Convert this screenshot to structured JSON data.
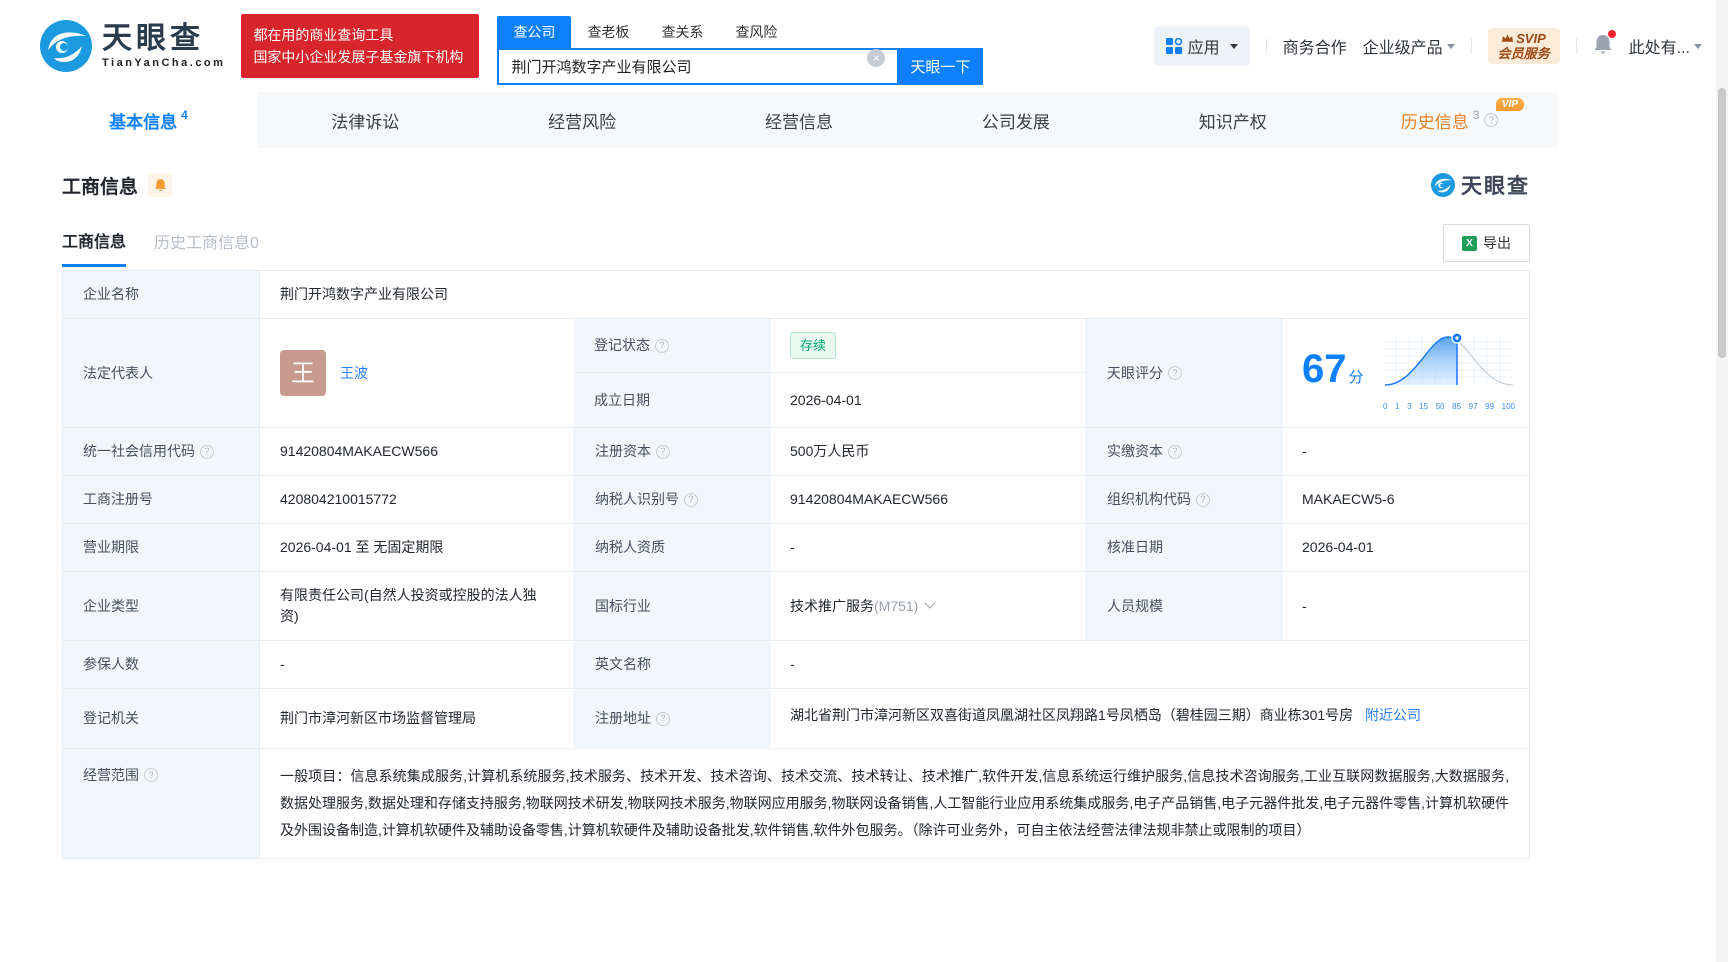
{
  "colors": {
    "accent": "#0d80ff",
    "banner_red": "#d7252b",
    "status_green": "#00a870",
    "vip_orange": "#f59a2e"
  },
  "header": {
    "logo": {
      "title": "天眼查",
      "domain": "TianYanCha.com"
    },
    "banner": {
      "line1": "都在用的商业查询工具",
      "line2": "国家中小企业发展子基金旗下机构"
    },
    "search": {
      "tabs": [
        {
          "label": "查公司",
          "active": true
        },
        {
          "label": "查老板",
          "active": false
        },
        {
          "label": "查关系",
          "active": false
        },
        {
          "label": "查风险",
          "active": false
        }
      ],
      "value": "荆门开鸿数字产业有限公司",
      "button": "天眼一下"
    },
    "nav": {
      "apps": "应用",
      "coop": "商务合作",
      "enterprise": "企业级产品",
      "svip": {
        "line1": "SVIP",
        "line2": "会员服务"
      },
      "user": "此处有..."
    }
  },
  "tabs": [
    {
      "label": "基本信息",
      "count": "4",
      "active": true
    },
    {
      "label": "法律诉讼"
    },
    {
      "label": "经营风险"
    },
    {
      "label": "经营信息"
    },
    {
      "label": "公司发展"
    },
    {
      "label": "知识产权"
    },
    {
      "label": "历史信息",
      "count": "3",
      "badge": "VIP"
    }
  ],
  "section": {
    "title": "工商信息",
    "watermark": "天眼查",
    "subtabs": [
      {
        "label": "工商信息",
        "active": true
      },
      {
        "label": "历史工商信息0",
        "active": false
      }
    ],
    "export_label": "导出"
  },
  "table": {
    "company_name": {
      "label": "企业名称",
      "value": "荆门开鸿数字产业有限公司"
    },
    "legal_rep": {
      "label": "法定代表人",
      "avatar": "王",
      "name": "王波"
    },
    "reg_status": {
      "label": "登记状态",
      "value": "存续"
    },
    "est_date": {
      "label": "成立日期",
      "value": "2026-04-01"
    },
    "score": {
      "label": "天眼评分",
      "value": "67",
      "unit": "分",
      "ticks": [
        "0",
        "1",
        "3",
        "15",
        "50",
        "85",
        "97",
        "99",
        "100"
      ]
    },
    "credit_code": {
      "label": "统一社会信用代码",
      "value": "91420804MAKAECW566"
    },
    "reg_capital": {
      "label": "注册资本",
      "value": "500万人民币"
    },
    "paid_capital": {
      "label": "实缴资本",
      "value": "-"
    },
    "reg_number": {
      "label": "工商注册号",
      "value": "420804210015772"
    },
    "taxpayer_id": {
      "label": "纳税人识别号",
      "value": "91420804MAKAECW566"
    },
    "org_code": {
      "label": "组织机构代码",
      "value": "MAKAECW5-6"
    },
    "business_term": {
      "label": "营业期限",
      "value": "2026-04-01 至 无固定期限"
    },
    "taxpayer_quality": {
      "label": "纳税人资质",
      "value": "-"
    },
    "approval_date": {
      "label": "核准日期",
      "value": "2026-04-01"
    },
    "company_type": {
      "label": "企业类型",
      "value": "有限责任公司(自然人投资或控股的法人独资)"
    },
    "industry": {
      "label": "国标行业",
      "value": "技术推广服务",
      "code": "(M751)"
    },
    "staff_size": {
      "label": "人员规模",
      "value": "-"
    },
    "insured_count": {
      "label": "参保人数",
      "value": "-"
    },
    "english_name": {
      "label": "英文名称",
      "value": "-"
    },
    "reg_authority": {
      "label": "登记机关",
      "value": "荆门市漳河新区市场监督管理局"
    },
    "reg_address": {
      "label": "注册地址",
      "value": "湖北省荆门市漳河新区双喜街道凤凰湖社区凤翔路1号凤栖岛（碧桂园三期）商业栋301号房",
      "link": "附近公司"
    },
    "business_scope": {
      "label": "经营范围",
      "value": "一般项目：信息系统集成服务,计算机系统服务,技术服务、技术开发、技术咨询、技术交流、技术转让、技术推广,软件开发,信息系统运行维护服务,信息技术咨询服务,工业互联网数据服务,大数据服务,数据处理服务,数据处理和存储支持服务,物联网技术研发,物联网技术服务,物联网应用服务,物联网设备销售,人工智能行业应用系统集成服务,电子产品销售,电子元器件批发,电子元器件零售,计算机软硬件及外围设备制造,计算机软硬件及辅助设备零售,计算机软硬件及辅助设备批发,软件销售,软件外包服务。（除许可业务外，可自主依法经营法律法规非禁止或限制的项目）"
    }
  }
}
